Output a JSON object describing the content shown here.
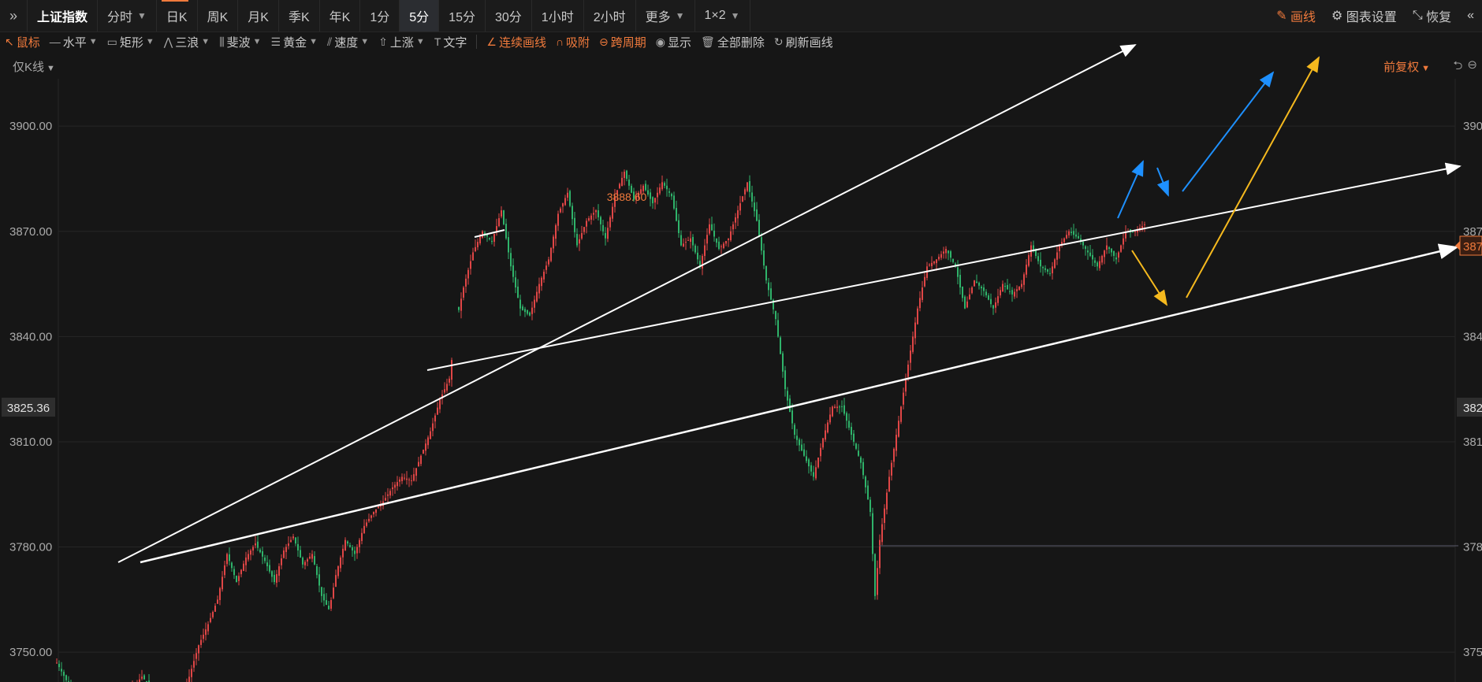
{
  "topbar": {
    "expand_icon": "double-chevron-right-icon",
    "index_name": "上证指数",
    "periods": [
      "分时",
      "日K",
      "周K",
      "月K",
      "季K",
      "年K",
      "1分",
      "5分",
      "15分",
      "30分",
      "1小时",
      "2小时",
      "更多",
      "1×2"
    ],
    "active_period": "5分",
    "right": {
      "draw": "画线",
      "settings": "图表设置",
      "restore": "恢复"
    }
  },
  "toolbar": {
    "items": [
      "鼠标",
      "水平",
      "矩形",
      "三浪",
      "斐波",
      "黄金",
      "速度",
      "上涨",
      "文字"
    ],
    "actions": [
      "连续画线",
      "吸附",
      "跨周期",
      "显示",
      "全部删除",
      "刷新画线"
    ]
  },
  "sub_label": "仅K线",
  "adjust_label": "前复权",
  "colors": {
    "up": "#e04646",
    "down": "#2fb36a",
    "accent": "#f07a3c",
    "white_line": "#ffffff",
    "blue": "#1e90ff",
    "yellow": "#f5b91e",
    "grid": "#262626"
  },
  "chart_data": {
    "type": "candlestick",
    "ylim": [
      3741.5,
      3918.0
    ],
    "y_ticks": [
      3900.0,
      3870.0,
      3840.0,
      3810.0,
      3780.0,
      3750.0
    ],
    "y_tick_labels": [
      "3900.00",
      "3870.00",
      "3840.00",
      "3810.00",
      "3780.00",
      "3750.00"
    ],
    "right_tick_labels": [
      "390",
      "387",
      "384",
      "381",
      "378",
      "375"
    ],
    "current_price_label": "387",
    "crosshair_price": "3825.36",
    "right_crosshair_label": "382",
    "high_label": "3888.60",
    "close_path": [
      [
        60,
        3747
      ],
      [
        70,
        3742
      ],
      [
        80,
        3738
      ],
      [
        100,
        3735
      ],
      [
        120,
        3737
      ],
      [
        140,
        3740
      ],
      [
        150,
        3743
      ],
      [
        160,
        3740
      ],
      [
        180,
        3736
      ],
      [
        195,
        3738
      ],
      [
        200,
        3743
      ],
      [
        210,
        3752
      ],
      [
        220,
        3758
      ],
      [
        230,
        3765
      ],
      [
        240,
        3778
      ],
      [
        250,
        3770
      ],
      [
        260,
        3777
      ],
      [
        270,
        3781
      ],
      [
        280,
        3776
      ],
      [
        290,
        3770
      ],
      [
        300,
        3779
      ],
      [
        310,
        3783
      ],
      [
        320,
        3775
      ],
      [
        330,
        3778
      ],
      [
        340,
        3766
      ],
      [
        348,
        3762
      ],
      [
        355,
        3772
      ],
      [
        365,
        3782
      ],
      [
        375,
        3778
      ],
      [
        385,
        3786
      ],
      [
        395,
        3790
      ],
      [
        405,
        3793
      ],
      [
        415,
        3797
      ],
      [
        425,
        3800
      ],
      [
        435,
        3799
      ],
      [
        445,
        3806
      ],
      [
        455,
        3813
      ],
      [
        465,
        3822
      ],
      [
        475,
        3828
      ],
      [
        483,
        3845
      ],
      [
        490,
        3854
      ],
      [
        500,
        3864
      ],
      [
        510,
        3870
      ],
      [
        520,
        3867
      ],
      [
        530,
        3876
      ],
      [
        540,
        3860
      ],
      [
        550,
        3848
      ],
      [
        560,
        3846
      ],
      [
        570,
        3855
      ],
      [
        580,
        3862
      ],
      [
        590,
        3875
      ],
      [
        600,
        3881
      ],
      [
        610,
        3866
      ],
      [
        620,
        3873
      ],
      [
        630,
        3876
      ],
      [
        640,
        3868
      ],
      [
        650,
        3880
      ],
      [
        660,
        3887
      ],
      [
        670,
        3879
      ],
      [
        680,
        3883
      ],
      [
        690,
        3878
      ],
      [
        700,
        3884
      ],
      [
        710,
        3880
      ],
      [
        720,
        3866
      ],
      [
        730,
        3868
      ],
      [
        740,
        3860
      ],
      [
        750,
        3872
      ],
      [
        760,
        3865
      ],
      [
        770,
        3868
      ],
      [
        780,
        3876
      ],
      [
        790,
        3884
      ],
      [
        800,
        3873
      ],
      [
        810,
        3856
      ],
      [
        820,
        3845
      ],
      [
        830,
        3825
      ],
      [
        840,
        3812
      ],
      [
        850,
        3806
      ],
      [
        860,
        3800
      ],
      [
        870,
        3811
      ],
      [
        880,
        3820
      ],
      [
        890,
        3820
      ],
      [
        900,
        3812
      ],
      [
        910,
        3804
      ],
      [
        920,
        3790
      ],
      [
        925,
        3766
      ],
      [
        930,
        3782
      ],
      [
        940,
        3800
      ],
      [
        950,
        3816
      ],
      [
        960,
        3832
      ],
      [
        970,
        3848
      ],
      [
        980,
        3860
      ],
      [
        990,
        3862
      ],
      [
        1000,
        3865
      ],
      [
        1010,
        3860
      ],
      [
        1020,
        3848
      ],
      [
        1030,
        3856
      ],
      [
        1040,
        3853
      ],
      [
        1050,
        3848
      ],
      [
        1060,
        3855
      ],
      [
        1070,
        3852
      ],
      [
        1080,
        3855
      ],
      [
        1090,
        3866
      ],
      [
        1100,
        3860
      ],
      [
        1110,
        3858
      ],
      [
        1120,
        3866
      ],
      [
        1130,
        3870
      ],
      [
        1140,
        3868
      ],
      [
        1150,
        3864
      ],
      [
        1160,
        3860
      ],
      [
        1170,
        3866
      ],
      [
        1180,
        3862
      ],
      [
        1190,
        3870
      ],
      [
        1200,
        3870
      ],
      [
        1210,
        3872
      ]
    ],
    "annotations": [
      {
        "type": "arrow",
        "color": "white",
        "from": [
          150,
          3776
        ],
        "to": [
          1440,
          3958
        ]
      },
      {
        "type": "line",
        "color": "white",
        "from": [
          502,
          3880
        ],
        "to": [
          600,
          3883
        ]
      },
      {
        "type": "arrow",
        "color": "white",
        "from": [
          452,
          3837
        ],
        "to": [
          1545,
          3902
        ]
      },
      {
        "type": "arrow",
        "color": "white",
        "from": [
          150,
          3776
        ],
        "to": [
          1540,
          3876
        ]
      },
      {
        "type": "line",
        "color": "grey",
        "from": [
          930,
          3782
        ],
        "to": [
          1540,
          3782
        ]
      }
    ]
  }
}
